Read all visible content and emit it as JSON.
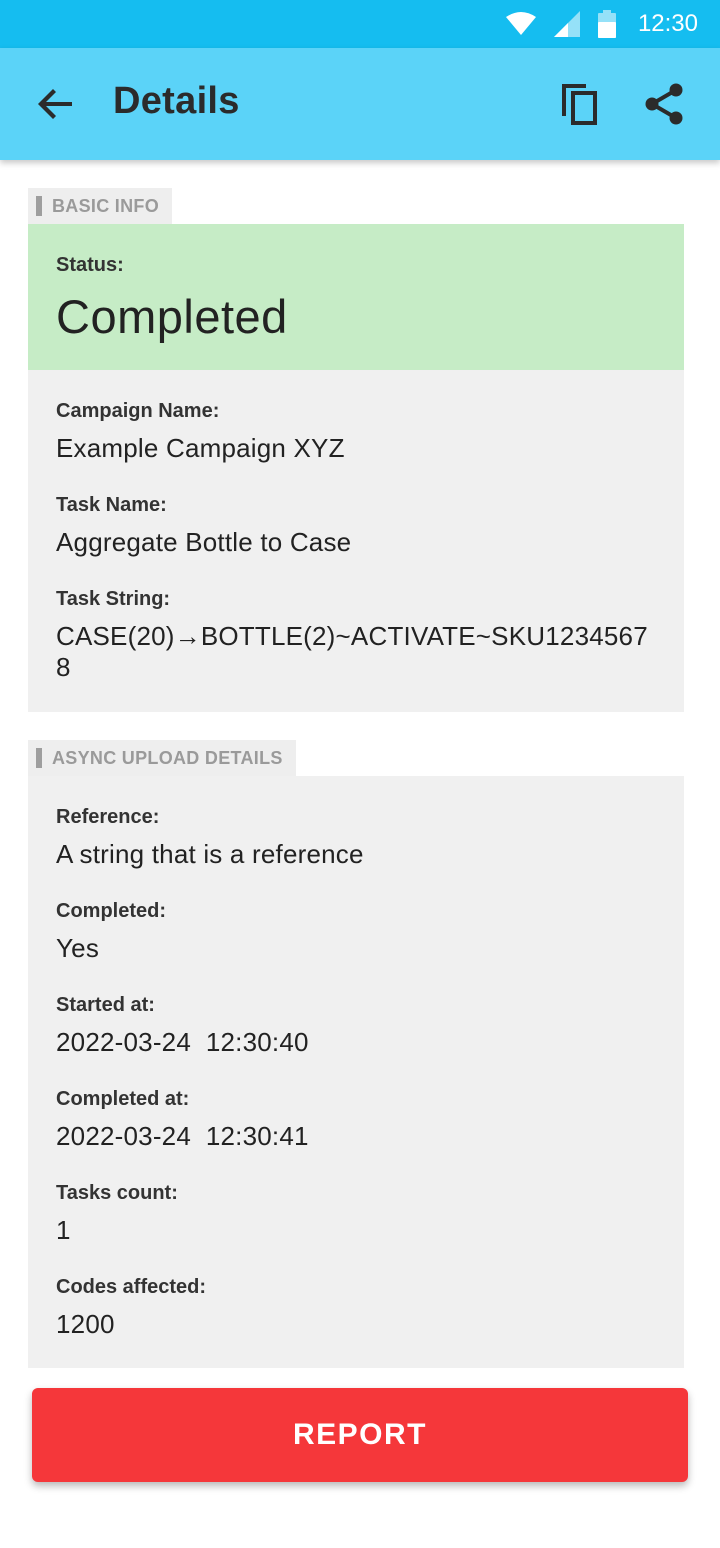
{
  "status_bar": {
    "time": "12:30",
    "icons": [
      "wifi-icon",
      "signal-icon",
      "battery-icon"
    ]
  },
  "app_bar": {
    "title": "Details",
    "back_icon": "arrow-back-icon",
    "copy_icon": "copy-icon",
    "share_icon": "share-icon"
  },
  "basic_info": {
    "header": "BASIC INFO",
    "status_label": "Status:",
    "status_value": "Completed",
    "fields": [
      {
        "label": "Campaign Name:",
        "value": "Example Campaign XYZ"
      },
      {
        "label": "Task Name:",
        "value": "Aggregate Bottle to Case"
      },
      {
        "label": "Task String:",
        "value": "CASE(20)→BOTTLE(2)~ACTIVATE~SKU12345678"
      }
    ]
  },
  "async_upload": {
    "header": "ASYNC UPLOAD DETAILS",
    "fields": [
      {
        "label": "Reference:",
        "value": "A string that is a reference"
      },
      {
        "label": "Completed:",
        "value": "Yes"
      },
      {
        "label": "Started at:",
        "value": "2022-03-24  12:30:40"
      },
      {
        "label": "Completed at:",
        "value": "2022-03-24  12:30:41"
      },
      {
        "label": "Tasks count:",
        "value": "1"
      },
      {
        "label": "Codes affected:",
        "value": "1200"
      }
    ]
  },
  "report_button": {
    "label": "REPORT"
  },
  "colors": {
    "status_bar": "#15bdf0",
    "app_bar": "#5bd3f8",
    "status_completed": "#c6ecc6",
    "card_background": "#f0f0f0",
    "report_button": "#f5373a"
  }
}
